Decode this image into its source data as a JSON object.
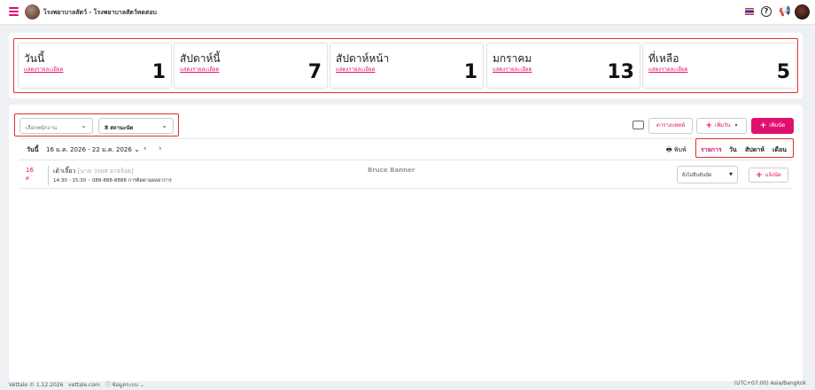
{
  "header": {
    "clinic_name": "โรงพยาบาลสัตว์ - โรงพยาบาลสัตว์ทดสอบ"
  },
  "stats": [
    {
      "title": "วันนี้",
      "link": "แสดงรายละเอียด",
      "count": "1"
    },
    {
      "title": "สัปดาห์นี้",
      "link": "แสดงรายละเอียด",
      "count": "7"
    },
    {
      "title": "สัปดาห์หน้า",
      "link": "แสดงรายละเอียด",
      "count": "1"
    },
    {
      "title": "มกราคม",
      "link": "แสดงรายละเอียด",
      "count": "13"
    },
    {
      "title": "ที่เหลือ",
      "link": "แสดงรายละเอียด",
      "count": "5"
    }
  ],
  "filters": {
    "employee_placeholder": "เลือกพนักงาน",
    "status_value": "8 สถานะนัด"
  },
  "toolbar": {
    "schedule_label": "ตารางแพทย์",
    "add_day_label": "เพิ่มวัน",
    "add_appt_label": "เพิ่มนัด"
  },
  "calendar": {
    "today_label": "วันนี้",
    "range": "16 ม.ค. 2026 - 22 ม.ค. 2026",
    "print_label": "พิมพ์",
    "views": [
      "รายการ",
      "วัน",
      "สัปดาห์",
      "เดือน"
    ]
  },
  "appointment": {
    "date": "16",
    "date_sub": "ศ",
    "title": "เต้าเจี๊ยว",
    "owner": "[นาย วรยส อาจร้อย]",
    "time": "14:30 - 15:30",
    "phone": "088-888-8888",
    "note": "การติดตามผลอาการ",
    "doctor": "Bruce Banner",
    "status": "ยังไม่ยืนยันนัด",
    "notify_label": "แจ้งนัด"
  },
  "footer": {
    "version": "Vettale © 1.12.2026",
    "site": "vettale.com",
    "system_info": "ข้อมูลระบบ",
    "timezone": "(UTC+07:00) Asia/Bangkok"
  },
  "colors": {
    "accent": "#e0106e",
    "highlight": "#e03030"
  }
}
